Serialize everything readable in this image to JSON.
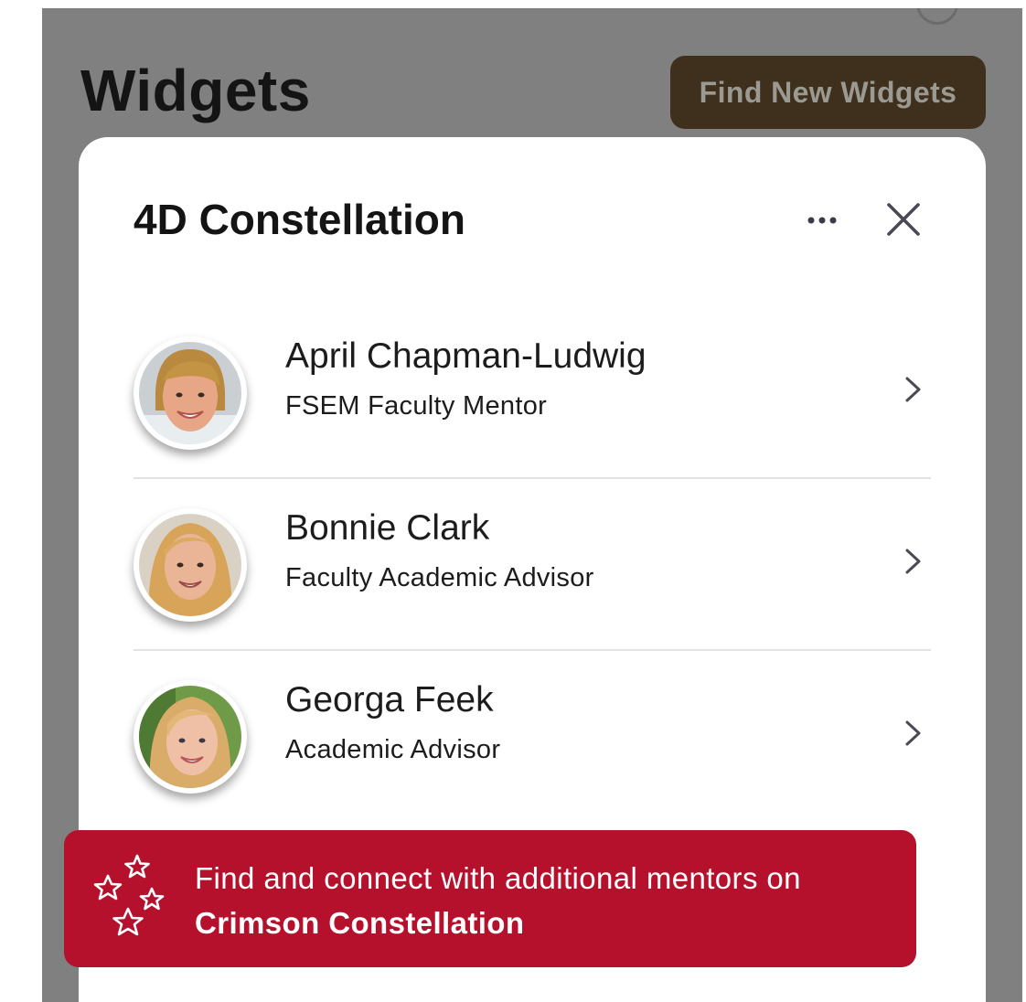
{
  "header": {
    "title": "Widgets",
    "find_button_label": "Find New Widgets"
  },
  "card": {
    "title": "4D Constellation",
    "more_icon": "ellipsis-icon",
    "close_icon": "close-icon",
    "people": [
      {
        "name": "April Chapman-Ludwig",
        "role": "FSEM Faculty Mentor"
      },
      {
        "name": "Bonnie Clark",
        "role": "Faculty Academic Advisor"
      },
      {
        "name": "Georga Feek",
        "role": "Academic Advisor"
      }
    ]
  },
  "banner": {
    "text": "Find and connect with additional mentors on",
    "link_text": "Crimson Constellation",
    "icon": "stars-icon"
  },
  "colors": {
    "overlay": "#808080",
    "find_button_bg": "#3f2f1d",
    "banner_bg": "#b5112c",
    "card_bg": "#ffffff"
  }
}
